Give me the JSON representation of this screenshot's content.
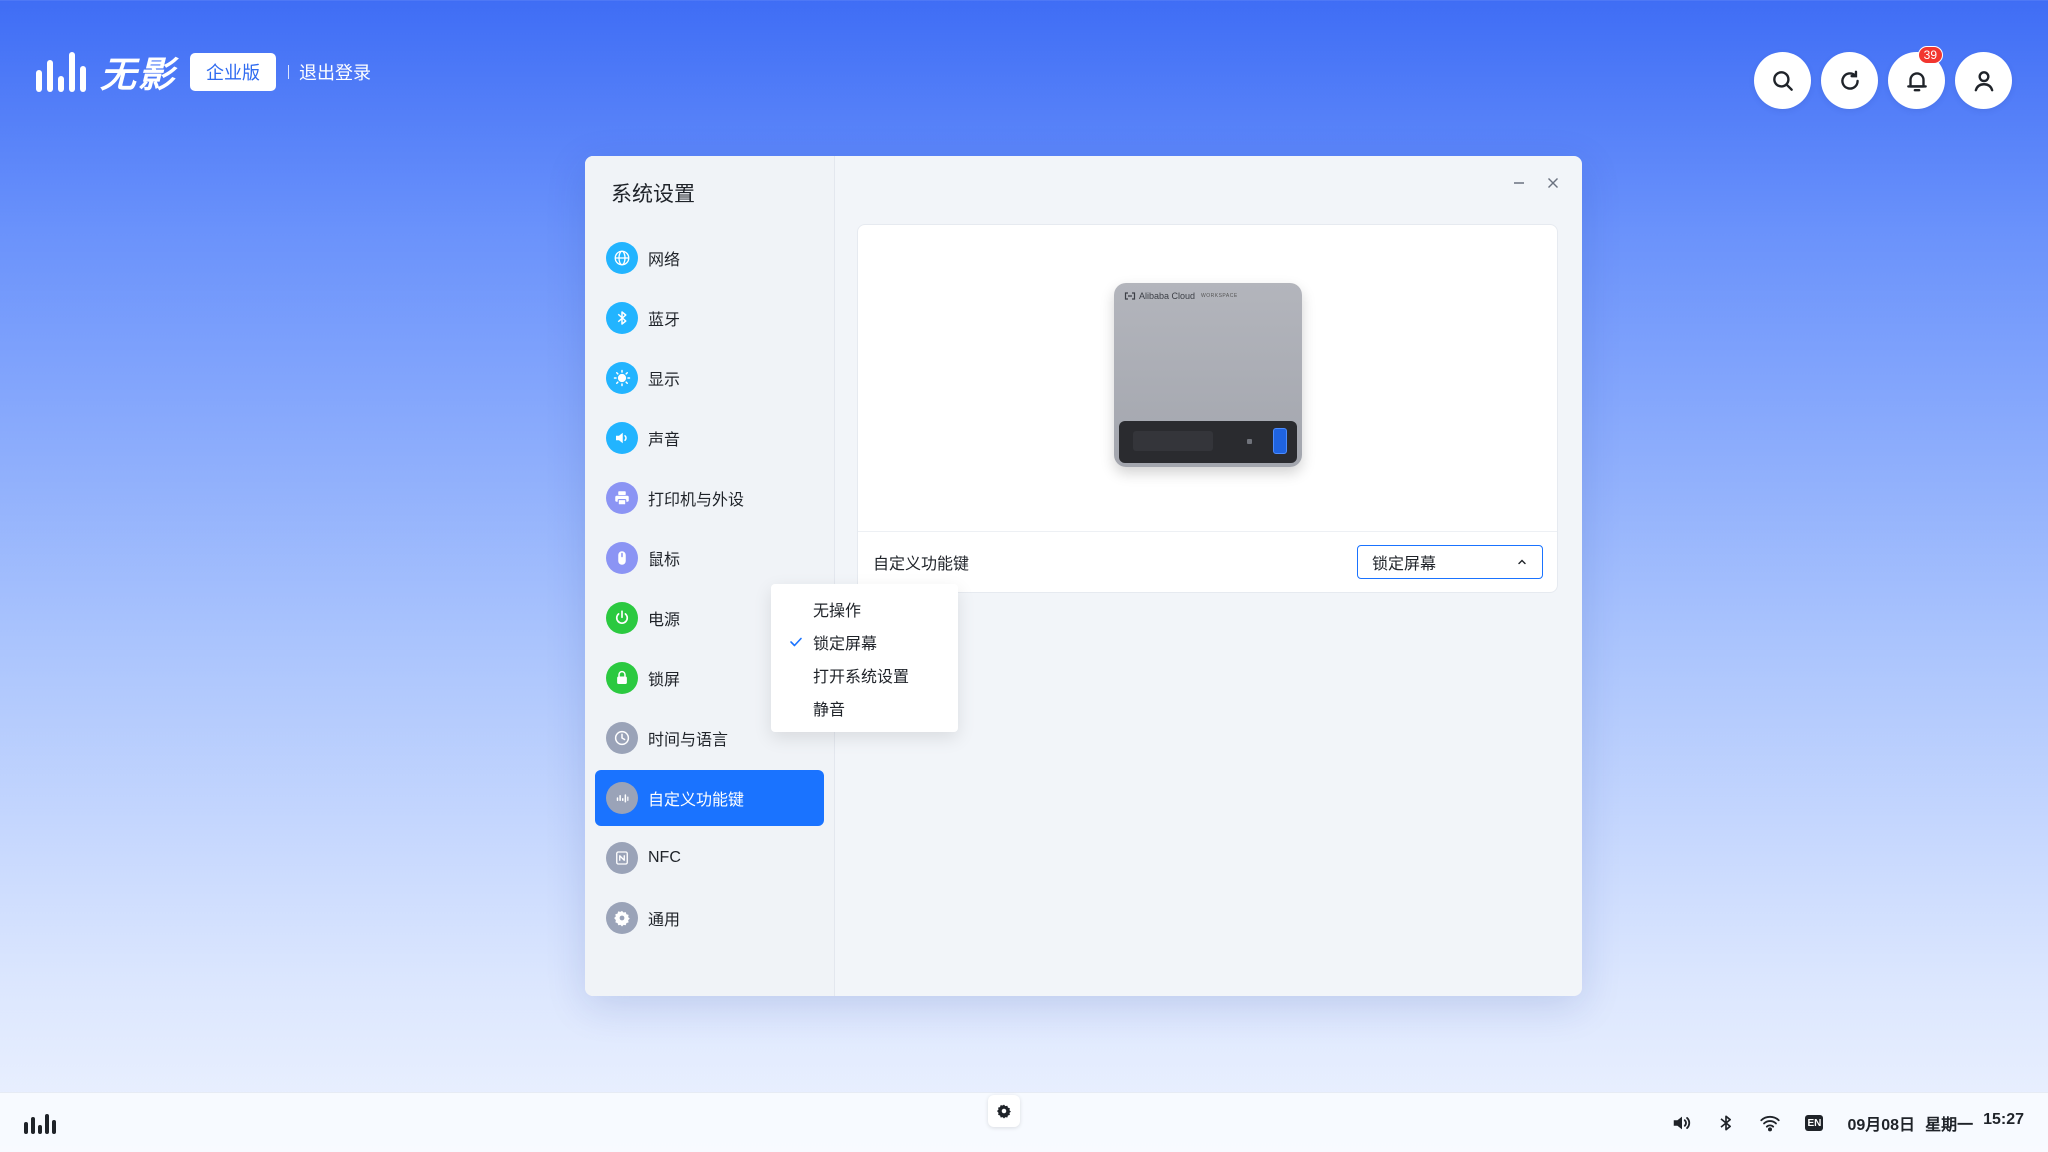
{
  "brand": {
    "name": "无影",
    "edition": "企业版",
    "logout": "退出登录"
  },
  "top_actions": {
    "notifications_count": "39"
  },
  "window": {
    "title": "系统设置",
    "nav": [
      {
        "label": "网络",
        "icon": "globe-icon",
        "color": "#22b4ff"
      },
      {
        "label": "蓝牙",
        "icon": "bluetooth-icon",
        "color": "#22b4ff"
      },
      {
        "label": "显示",
        "icon": "sun-icon",
        "color": "#22b4ff"
      },
      {
        "label": "声音",
        "icon": "speaker-icon",
        "color": "#22b4ff"
      },
      {
        "label": "打印机与外设",
        "icon": "printer-icon",
        "color": "#8b94f4"
      },
      {
        "label": "鼠标",
        "icon": "mouse-icon",
        "color": "#8b94f4"
      },
      {
        "label": "电源",
        "icon": "power-icon",
        "color": "#2bc940"
      },
      {
        "label": "锁屏",
        "icon": "lock-icon",
        "color": "#2bc940"
      },
      {
        "label": "时间与语言",
        "icon": "clock-icon",
        "color": "#9aa3b8"
      },
      {
        "label": "自定义功能键",
        "icon": "brand-key-icon",
        "color": "#9aa3b8",
        "active": true
      },
      {
        "label": "NFC",
        "icon": "nfc-icon",
        "color": "#9aa3b8"
      },
      {
        "label": "通用",
        "icon": "gear-icon",
        "color": "#9aa3b8"
      }
    ],
    "device_brand": "Alibaba Cloud",
    "device_sub": "WORKSPACE",
    "row_label": "自定义功能键",
    "select_value": "锁定屏幕",
    "options": [
      {
        "label": "无操作",
        "selected": false
      },
      {
        "label": "锁定屏幕",
        "selected": true
      },
      {
        "label": "打开系统设置",
        "selected": false
      },
      {
        "label": "静音",
        "selected": false
      }
    ]
  },
  "taskbar": {
    "lang": "EN",
    "date": "09月08日",
    "weekday": "星期一",
    "time": "15:27"
  },
  "colors": {
    "accent": "#1a73ff",
    "badge_red": "#f2362f"
  }
}
